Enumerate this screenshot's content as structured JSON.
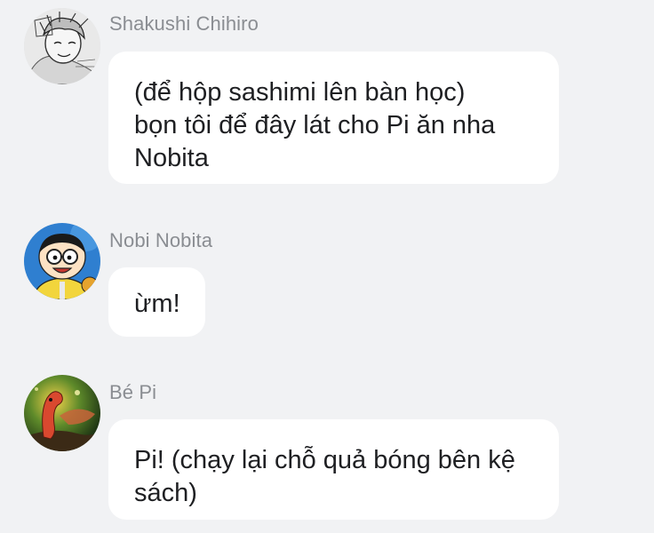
{
  "messages": [
    {
      "sender": "Shakushi Chihiro",
      "avatar_icon": "sketch-portrait-avatar",
      "lines": [
        "(để hộp sashimi lên bàn học)",
        "bọn tôi để đây lát cho Pi ăn nha",
        "Nobita"
      ]
    },
    {
      "sender": "Nobi Nobita",
      "avatar_icon": "cartoon-boy-avatar",
      "lines": [
        "ừm!"
      ]
    },
    {
      "sender": "Bé Pi",
      "avatar_icon": "dino-scene-avatar",
      "lines": [
        "Pi! (chạy lại chỗ quả bóng bên kệ",
        "sách)"
      ]
    }
  ],
  "colors": {
    "background": "#f1f2f4",
    "bubble": "#ffffff",
    "sender_name": "#8a8d92",
    "message_text": "#1e1f22"
  }
}
